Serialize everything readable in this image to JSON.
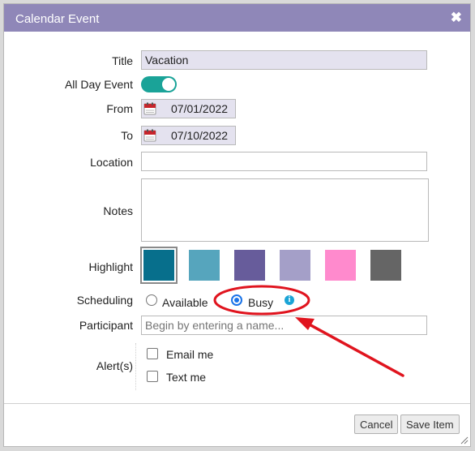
{
  "dialog": {
    "title": "Calendar Event",
    "close_glyph": "✖"
  },
  "fields": {
    "title_label": "Title",
    "title_value": "Vacation",
    "all_day_label": "All Day Event",
    "all_day_on": true,
    "from_label": "From",
    "from_value": "07/01/2022",
    "to_label": "To",
    "to_value": "07/10/2022",
    "location_label": "Location",
    "location_value": "",
    "notes_label": "Notes",
    "notes_value": "",
    "highlight_label": "Highlight",
    "highlight_colors": [
      "#076f8c",
      "#56a5bd",
      "#675c9b",
      "#a49fc8",
      "#ff8acd",
      "#656565"
    ],
    "highlight_selected_index": 0,
    "scheduling_label": "Scheduling",
    "scheduling_options": [
      "Available",
      "Busy"
    ],
    "scheduling_selected": "Busy",
    "participant_label": "Participant",
    "participant_placeholder": "Begin by entering a name...",
    "alerts_label": "Alert(s)",
    "alert_options": [
      "Email me",
      "Text me"
    ]
  },
  "buttons": {
    "cancel": "Cancel",
    "save": "Save Item"
  },
  "icons": {
    "calendar": "calendar-icon",
    "info": "info-icon",
    "close": "close-icon"
  },
  "colors": {
    "titlebar": "#8f87b8",
    "toggle_on": "#1aa398",
    "annotation": "#e0141e"
  }
}
